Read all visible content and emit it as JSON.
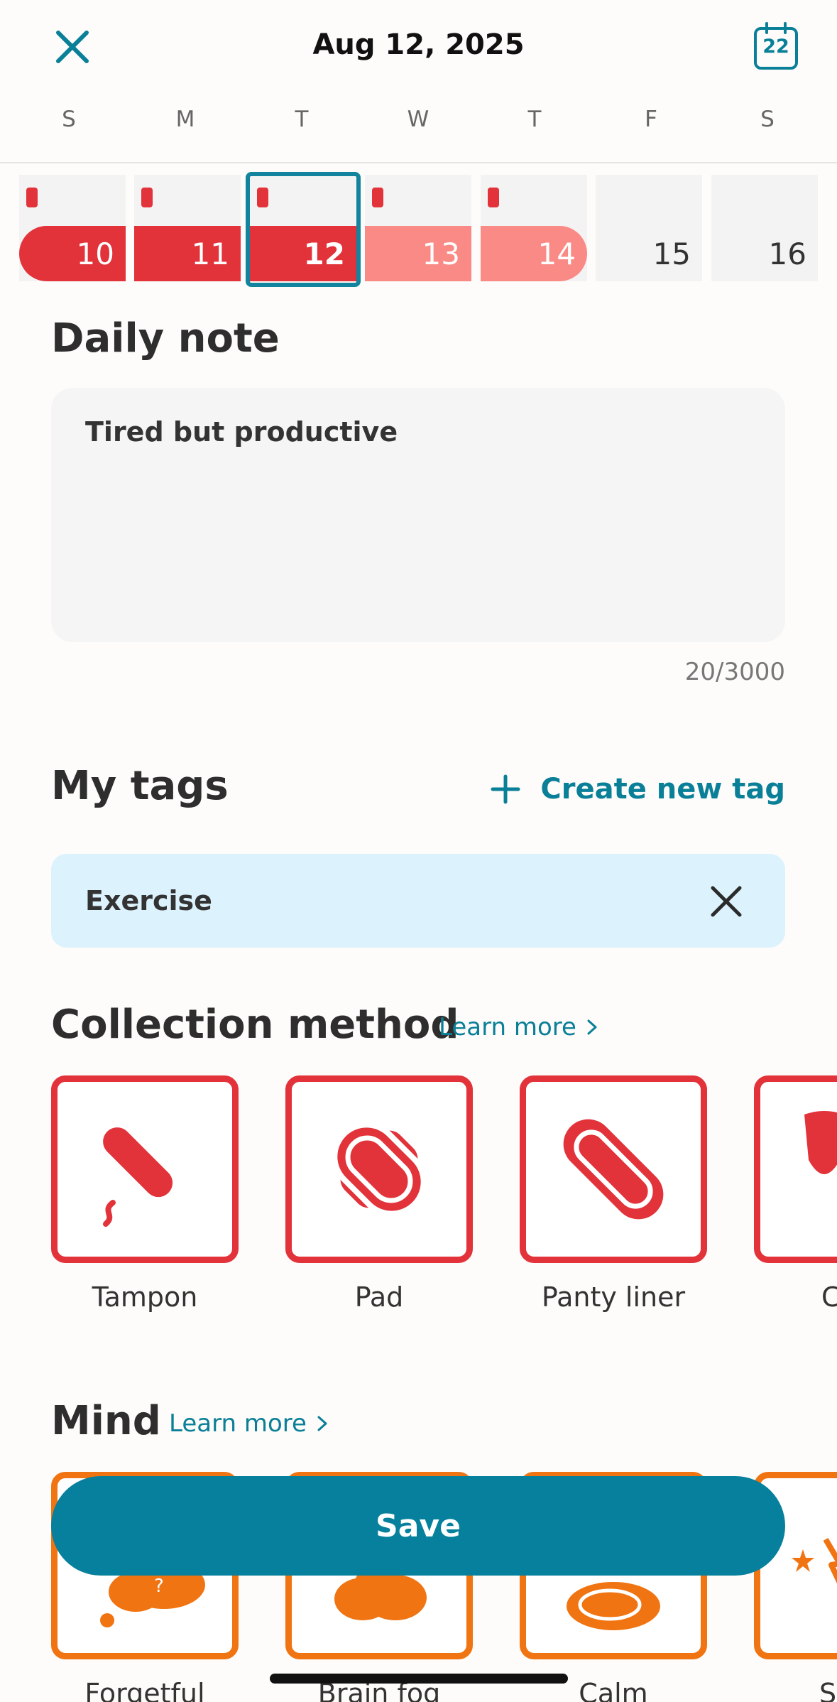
{
  "header": {
    "title": "Aug 12, 2025",
    "calendar_day": "22"
  },
  "weekdays": [
    "S",
    "M",
    "T",
    "W",
    "T",
    "F",
    "S"
  ],
  "week": [
    {
      "day": "10",
      "flow": true,
      "period": "heavy",
      "selected": false
    },
    {
      "day": "11",
      "flow": true,
      "period": "heavy",
      "selected": false
    },
    {
      "day": "12",
      "flow": true,
      "period": "heavy",
      "selected": true
    },
    {
      "day": "13",
      "flow": true,
      "period": "light",
      "selected": false
    },
    {
      "day": "14",
      "flow": true,
      "period": "light",
      "selected": false
    },
    {
      "day": "15",
      "flow": false,
      "period": "none",
      "selected": false
    },
    {
      "day": "16",
      "flow": false,
      "period": "none",
      "selected": false
    }
  ],
  "daily_note": {
    "title": "Daily note",
    "value": "Tired but productive",
    "counter": "20/3000"
  },
  "tags": {
    "title": "My tags",
    "create_label": "Create new tag",
    "items": [
      "Exercise"
    ]
  },
  "collection": {
    "title": "Collection method",
    "learn_more": "Learn more",
    "options": [
      "Tampon",
      "Pad",
      "Panty liner",
      "C"
    ]
  },
  "mind": {
    "title": "Mind",
    "learn_more": "Learn more",
    "options": [
      "Forgetful",
      "Brain fog",
      "Calm",
      "Stre"
    ]
  },
  "save_label": "Save",
  "colors": {
    "accent": "#0a7f98",
    "period_heavy": "#e2323a",
    "period_light": "#fa8a86",
    "mind": "#f07411",
    "tag_bg": "#dcf2fc"
  }
}
